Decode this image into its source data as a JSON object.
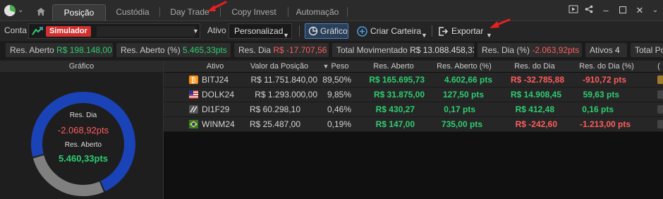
{
  "tabs": [
    "Posição",
    "Custódia",
    "Day Trade",
    "Copy Invest",
    "Automação"
  ],
  "toolbar": {
    "conta_label": "Conta",
    "account_badge": "Simulador",
    "ativo_label": "Ativo",
    "ativo_value": "Personalizad",
    "grafico_label": "Gráfico",
    "criar_label": "Criar Carteira",
    "exportar_label": "Exportar"
  },
  "stats": [
    {
      "label": "Res. Aberto",
      "value": "R$ 198.148,00",
      "tone": "pos"
    },
    {
      "label": "Res. Aberto (%)",
      "value": "5.465,33pts",
      "tone": "pos"
    },
    {
      "label": "Res. Dia",
      "value": "R$ -17.707,56",
      "tone": "neg"
    },
    {
      "label": "Total Movimentado",
      "value": "R$ 13.088.458,33",
      "tone": "neu"
    },
    {
      "label": "Res. Dia (%)",
      "value": "-2.063,92pts",
      "tone": "neg"
    },
    {
      "label": "Ativos",
      "value": "4",
      "tone": "neu"
    },
    {
      "label": "Total Po",
      "value": "",
      "tone": "neu"
    }
  ],
  "chart": {
    "header": "Gráfico",
    "dia_label": "Res. Dia",
    "dia_value": "-2.068,92pts",
    "aberto_label": "Res. Aberto",
    "aberto_value": "5.460,33pts"
  },
  "chart_data": {
    "type": "pie",
    "segments": [
      {
        "label": "Res. Aberto",
        "value": 5460.33,
        "color": "#1a43b8"
      },
      {
        "label": "Res. Dia",
        "value": -2068.92,
        "color": "#808080"
      }
    ]
  },
  "table": {
    "headers": [
      "Ativo",
      "Valor da Posição",
      "Peso",
      "Res. Aberto",
      "Res. Aberto (%)",
      "Res. do Dia",
      "Res. do Dia (%)"
    ],
    "rows": [
      {
        "icon": "bitcoin-icon",
        "ativo": "BITJ24",
        "valor": "R$ 11.751.840,00",
        "peso": "89,50%",
        "aberto": "R$ 165.695,73",
        "aberto_pct": "4.602,66 pts",
        "dia": "R$ -32.785,88",
        "dia_pct": "-910,72 pts",
        "aberto_tone": "pos",
        "dia_tone": "neg"
      },
      {
        "icon": "us-flag-icon",
        "ativo": "DOLK24",
        "valor": "R$ 1.293.000,00",
        "peso": "9,85%",
        "aberto": "R$ 31.875,00",
        "aberto_pct": "127,50 pts",
        "dia": "R$ 14.908,45",
        "dia_pct": "59,63 pts",
        "aberto_tone": "pos",
        "dia_tone": "pos"
      },
      {
        "icon": "di-icon",
        "ativo": "DI1F29",
        "valor": "R$ 60.298,10",
        "peso": "0,46%",
        "aberto": "R$ 430,27",
        "aberto_pct": "0,17 pts",
        "dia": "R$ 412,48",
        "dia_pct": "0,16 pts",
        "aberto_tone": "pos",
        "dia_tone": "pos"
      },
      {
        "icon": "brazil-flag-icon",
        "ativo": "WINM24",
        "valor": "R$ 25.487,00",
        "peso": "0,19%",
        "aberto": "R$ 147,00",
        "aberto_pct": "735,00 pts",
        "dia": "R$ -242,60",
        "dia_pct": "-1.213,00 pts",
        "aberto_tone": "pos",
        "dia_tone": "neg"
      }
    ]
  },
  "colors": {
    "positive": "#2ecc71",
    "negative": "#ff5c5c",
    "accent": "#4e7fb8",
    "badge": "#d32f2f",
    "annotation": "#e52020"
  }
}
